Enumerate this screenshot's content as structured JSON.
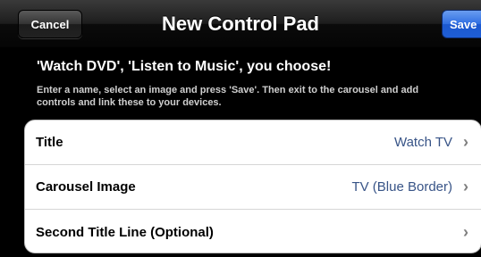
{
  "navbar": {
    "title": "New Control Pad",
    "cancel_label": "Cancel",
    "save_label": "Save"
  },
  "header": {
    "headline": "'Watch DVD', 'Listen to Music', you choose!",
    "instructions": "Enter a name, select an image and press 'Save'. Then exit to the carousel and add controls and link these to your devices."
  },
  "table": {
    "rows": [
      {
        "label": "Title",
        "value": "Watch TV",
        "icon": "chevron-right-icon"
      },
      {
        "label": "Carousel Image",
        "value": "TV (Blue Border)",
        "icon": "chevron-right-icon"
      },
      {
        "label": "Second Title Line (Optional)",
        "value": "",
        "icon": "chevron-right-icon"
      }
    ]
  },
  "colors": {
    "accent": "#2f6ee2",
    "value_text": "#385487",
    "background": "#000000"
  }
}
